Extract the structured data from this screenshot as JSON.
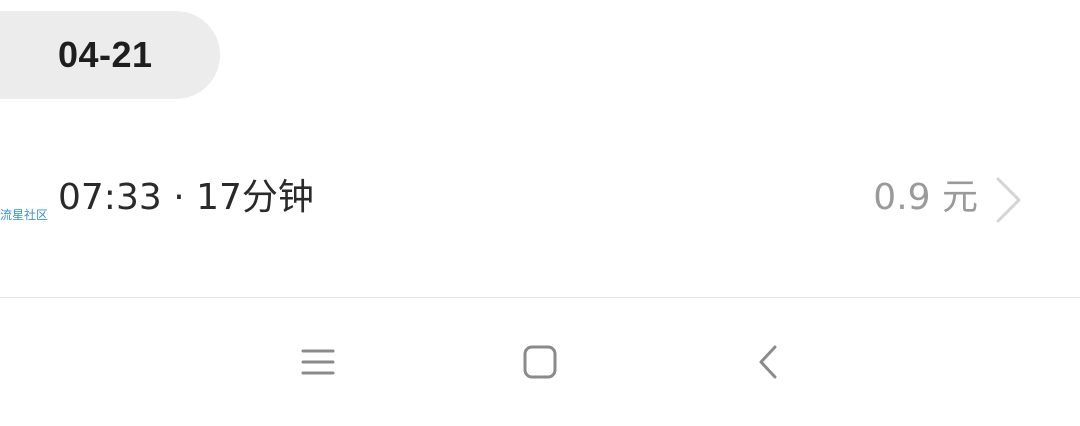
{
  "date_header": {
    "label": "04-21"
  },
  "ride": {
    "watermark": "流星社区",
    "time_duration": "07:33 · 17分钟",
    "fare": "0.9 元",
    "chevron_icon": "chevron-right-icon"
  },
  "navbar": {
    "icons": [
      "menu-icon",
      "home-square-icon",
      "back-arrow-icon"
    ]
  },
  "colors": {
    "date_pill_bg": "#ececec",
    "primary_text": "#2a2a2a",
    "secondary_text": "#9a9a9a",
    "watermark": "#3a8fd9",
    "icon_gray": "#8a8a8a"
  }
}
